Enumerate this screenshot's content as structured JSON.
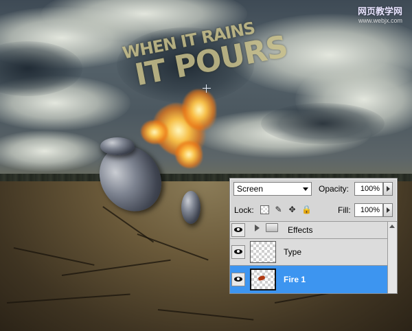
{
  "watermark": {
    "site_cn": "网页教学网",
    "url": "www.webjx.com"
  },
  "artwork": {
    "headline_line1": "WHEN IT RAINS",
    "headline_line2": "IT POURS"
  },
  "layers_panel": {
    "blend_mode": "Screen",
    "opacity_label": "Opacity:",
    "opacity_value": "100%",
    "lock_label": "Lock:",
    "fill_label": "Fill:",
    "fill_value": "100%",
    "layers": [
      {
        "name": "Effects",
        "type": "group",
        "visible": true,
        "selected": false
      },
      {
        "name": "Type",
        "type": "layer",
        "visible": true,
        "selected": false
      },
      {
        "name": "Fire 1",
        "type": "layer",
        "visible": true,
        "selected": true
      }
    ],
    "colors": {
      "selection": "#3d95f0",
      "panel_bg": "#d6d6d6"
    }
  }
}
